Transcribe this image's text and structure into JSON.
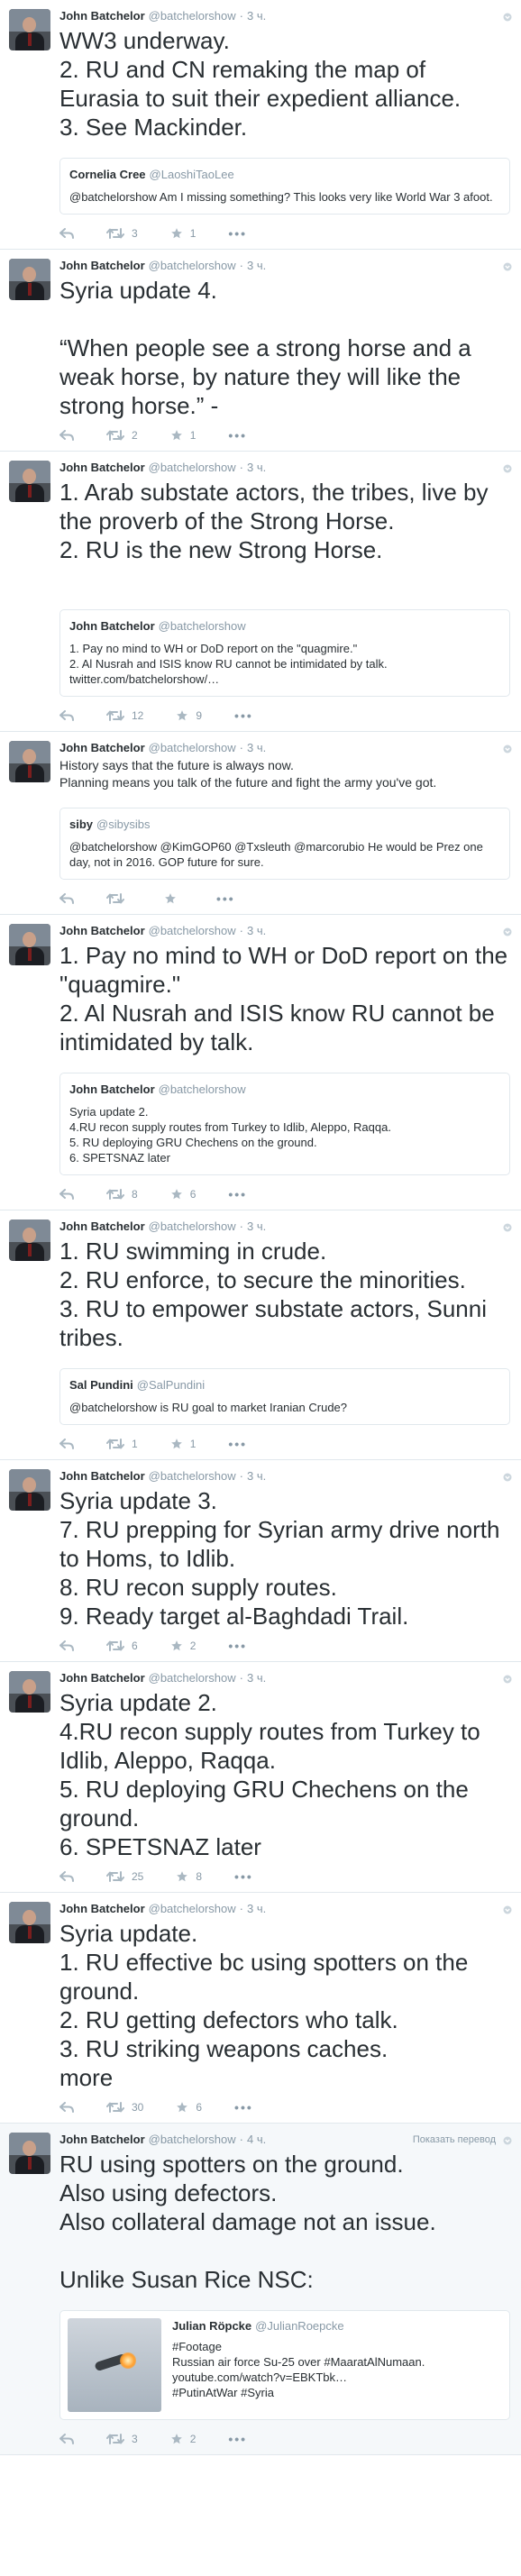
{
  "colors": {
    "text": "#292f33",
    "meta": "#8899a6",
    "border": "#e1e8ed",
    "highlight": "#f5f8fa"
  },
  "tweets": [
    {
      "author": "John Batchelor",
      "handle": "@batchelorshow",
      "time": "3 ч.",
      "text": "WW3 underway.\n2. RU and CN remaking the map of Eurasia to suit their expedient alliance.\n3. See Mackinder.",
      "quote": {
        "name": "Cornelia Cree",
        "handle": "@LaoshiTaoLee",
        "text": "@batchelorshow Am I missing something? This looks very like World War 3 afoot."
      },
      "retweets": "3",
      "favorites": "1"
    },
    {
      "author": "John Batchelor",
      "handle": "@batchelorshow",
      "time": "3 ч.",
      "text": "Syria update 4.\n\n“When people see a strong horse and a weak horse, by nature they will like the strong horse.” -",
      "retweets": "2",
      "favorites": "1"
    },
    {
      "author": "John Batchelor",
      "handle": "@batchelorshow",
      "time": "3 ч.",
      "text": "1. Arab substate actors, the tribes, live by the proverb of the Strong Horse.\n2. RU is the new Strong Horse.\n\n",
      "quote": {
        "name": "John Batchelor",
        "handle": "@batchelorshow",
        "text": "1. Pay no mind to WH or DoD report on the \"quagmire.\"\n2. Al Nusrah and ISIS know RU cannot be intimidated by talk. twitter.com/batchelorshow/…"
      },
      "retweets": "12",
      "favorites": "9"
    },
    {
      "author": "John Batchelor",
      "handle": "@batchelorshow",
      "time": "3 ч.",
      "text": "History says that the future is always now.\nPlanning means you talk of the future and fight the army you've got.",
      "small": true,
      "quote": {
        "name": "siby",
        "handle": "@sibysibs",
        "text": "@batchelorshow @KimGOP60 @Txsleuth @marcorubio He would be Prez one day, not in 2016. GOP future for sure."
      },
      "retweets": "",
      "favorites": ""
    },
    {
      "author": "John Batchelor",
      "handle": "@batchelorshow",
      "time": "3 ч.",
      "text": "1. Pay no mind to WH or DoD report on the \"quagmire.\"\n2. Al Nusrah and ISIS know RU cannot be intimidated by talk.",
      "quote": {
        "name": "John Batchelor",
        "handle": "@batchelorshow",
        "text": "Syria update 2.\n4.RU recon supply routes from Turkey to Idlib, Aleppo, Raqqa.\n5. RU deploying GRU Chechens on the ground.\n6. SPETSNAZ later"
      },
      "retweets": "8",
      "favorites": "6"
    },
    {
      "author": "John Batchelor",
      "handle": "@batchelorshow",
      "time": "3 ч.",
      "text": "1. RU swimming in crude.\n2. RU enforce, to secure the minorities.\n3. RU to empower substate actors, Sunni tribes.",
      "quote": {
        "name": "Sal Pundini",
        "handle": "@SalPundini",
        "text": "@batchelorshow is RU goal to market Iranian Crude?"
      },
      "retweets": "1",
      "favorites": "1"
    },
    {
      "author": "John Batchelor",
      "handle": "@batchelorshow",
      "time": "3 ч.",
      "text": "Syria update 3.\n7. RU prepping for Syrian army drive north to Homs, to Idlib.\n8. RU recon supply routes.\n9. Ready target al-Baghdadi Trail.",
      "retweets": "6",
      "favorites": "2"
    },
    {
      "author": "John Batchelor",
      "handle": "@batchelorshow",
      "time": "3 ч.",
      "text": "Syria update 2.\n4.RU recon supply routes from Turkey to Idlib, Aleppo, Raqqa.\n5. RU deploying GRU Chechens on the ground.\n6. SPETSNAZ later",
      "retweets": "25",
      "favorites": "8"
    },
    {
      "author": "John Batchelor",
      "handle": "@batchelorshow",
      "time": "3 ч.",
      "text": "Syria update.\n1. RU effective bc using spotters on the ground.\n2. RU getting defectors who talk.\n3. RU striking weapons caches.\nmore",
      "retweets": "30",
      "favorites": "6"
    },
    {
      "author": "John Batchelor",
      "handle": "@batchelorshow",
      "time": "4 ч.",
      "highlight": true,
      "translate": "Показать перевод",
      "text": "RU using spotters on the ground.\nAlso using defectors.\nAlso collateral damage not an issue.\n\nUnlike Susan Rice NSC:",
      "media_quote": {
        "name": "Julian Röpcke",
        "handle": "@JulianRoepcke",
        "text": "#Footage\nRussian air force Su-25 over #MaaratAlNumaan. youtube.com/watch?v=EBKTbk…\n#PutinAtWar #Syria"
      },
      "retweets": "3",
      "favorites": "2"
    }
  ]
}
